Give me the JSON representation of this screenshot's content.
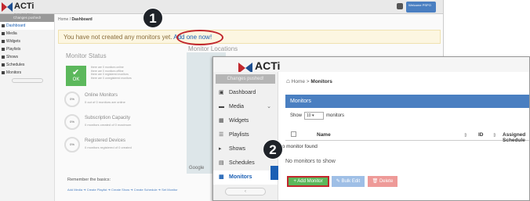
{
  "bg": {
    "logo": "ACTi",
    "logo_sub": "Connecting Vision",
    "user": "Welcome PSPO",
    "changes": "Changes pushed!",
    "nav": [
      "Dashboard",
      "Media",
      "Widgets",
      "Playlists",
      "Shows",
      "Schedules",
      "Monitors"
    ],
    "breadcrumb_home": "Home",
    "breadcrumb_current": "Dashboard",
    "alert_text": "You have not created any monitors yet.",
    "alert_link": "Add one now!",
    "monitor_status_title": "Monitor Status",
    "monitor_locations_title": "Monitor Locations",
    "ok_label": "OK",
    "ok_lines": [
      "there are 0 monitors online",
      "there are 0 monitors offline",
      "there are 0 registered monitors",
      "there are 0 unregistered monitors"
    ],
    "stats": [
      {
        "pct": "0%",
        "title": "Online Monitors",
        "desc": "0 out of 0 monitors are online"
      },
      {
        "pct": "0%",
        "title": "Subscription Capacity",
        "desc": "0 monitors created of 0 maximum"
      },
      {
        "pct": "0%",
        "title": "Registered Devices",
        "desc": "0 monitors registered of 0 created"
      }
    ],
    "map_label": "Google",
    "remember": "Remember the basics:",
    "basics": "Add Media  ➜  Create Playlist  ➜  Create Show  ➜  Create Schedule  ➜  Set Monitor"
  },
  "fg": {
    "logo": "ACTi",
    "logo_sub": "Connecting Vision",
    "changes": "Changes pushed!",
    "nav": [
      "Dashboard",
      "Media",
      "Widgets",
      "Playlists",
      "Shows",
      "Schedules",
      "Monitors"
    ],
    "breadcrumb_home": "Home",
    "breadcrumb_current": "Monitors",
    "panel_title": "Monitors",
    "show_label": "Show",
    "show_value": "10",
    "show_suffix": "monitors",
    "columns": [
      "Name",
      "ID",
      "Assigned Schedule"
    ],
    "no_found": "No monitor found",
    "no_show": "No monitors to show",
    "btn_add": "+ Add Monitor",
    "btn_bulk": "Bulk Edit",
    "btn_delete": "Delete"
  },
  "callouts": [
    "1",
    "2"
  ]
}
